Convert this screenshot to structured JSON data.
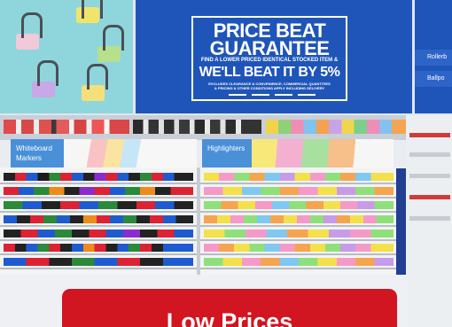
{
  "photo": {
    "banner": {
      "line1": "PRICE BEAT",
      "line2": "GUARANTEE",
      "line3": "FIND A LOWER PRICED IDENTICAL STOCKED ITEM &",
      "line4": "WE'LL BEAT IT BY 5%",
      "line5": "EXCLUDES CLEARANCE & CONVENIENCE, COMMERCIAL QUANTITIES",
      "line6": "& PRICING & OTHER CONDITIONS APPLY INCLUDING DELIVERY",
      "color": "#1f55b8"
    },
    "side_panel": {
      "row1": "Rollerb",
      "row2": "Ballpo"
    },
    "signs": {
      "whiteboard": "Whiteboard Markers",
      "highlighters": "Highlighters"
    }
  },
  "cta": {
    "label": "Low Prices",
    "color": "#d11521"
  }
}
